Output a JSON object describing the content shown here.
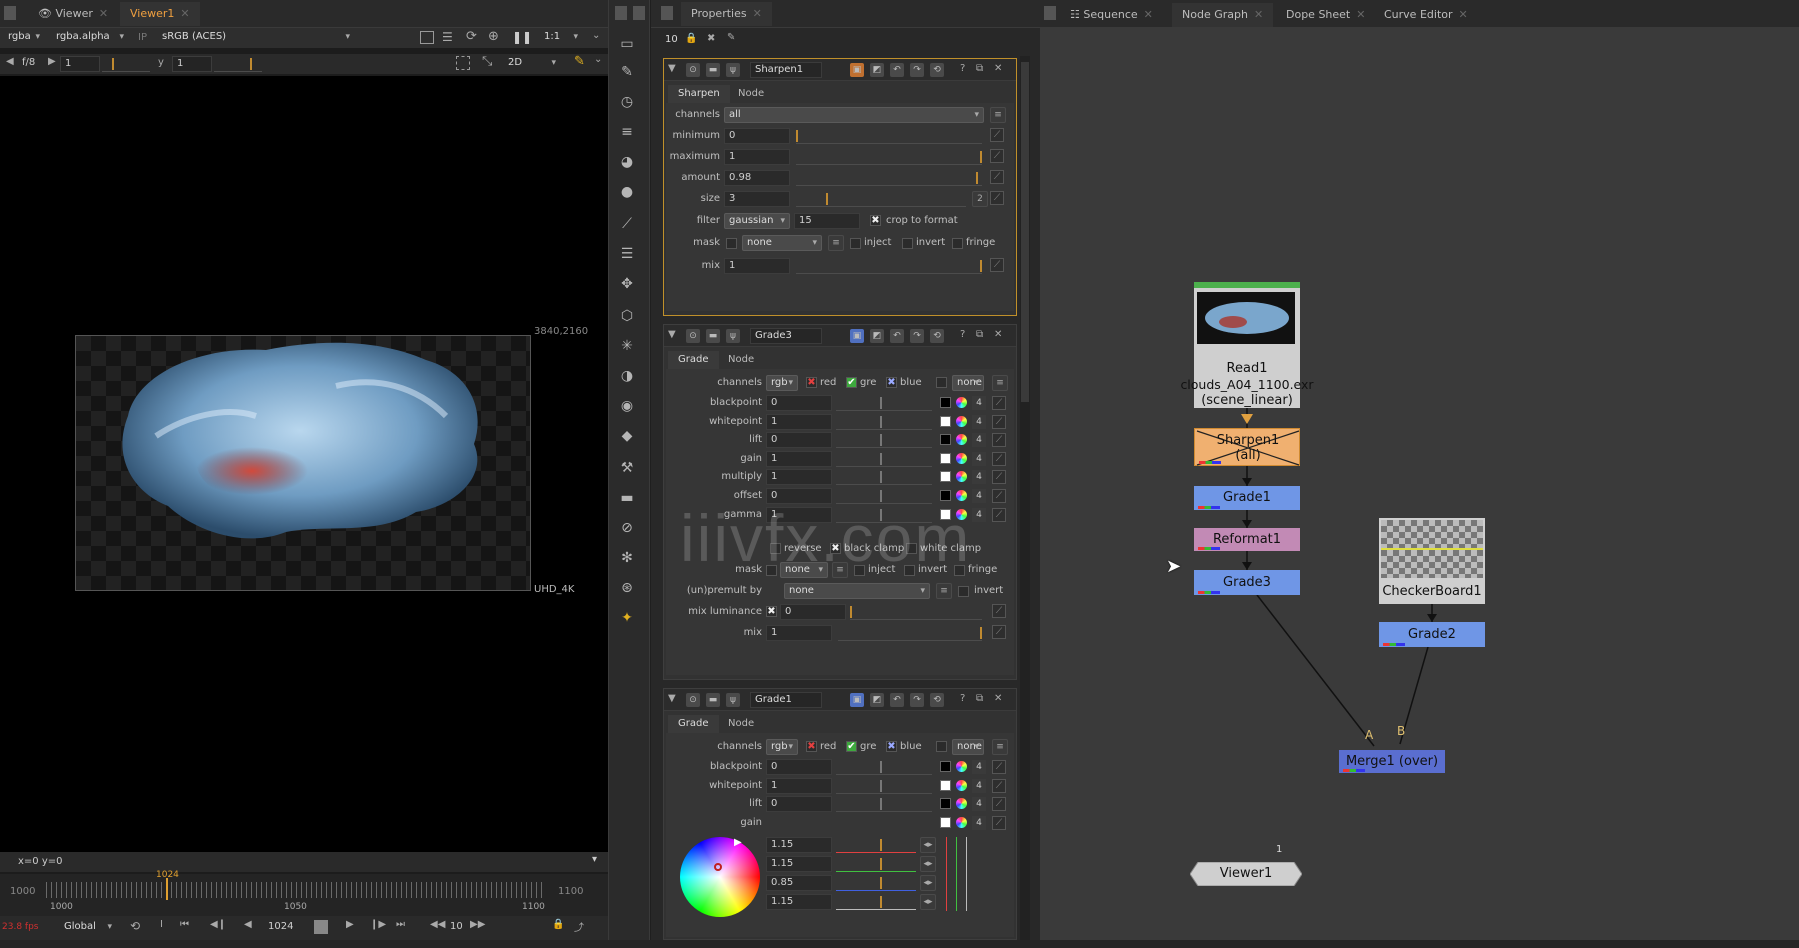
{
  "viewer": {
    "tabs": [
      {
        "label": "Viewer"
      },
      {
        "label": "Viewer1"
      }
    ],
    "channels": "rgba",
    "alpha": "rgba.alpha",
    "ip": "IP",
    "colorspace": "sRGB (ACES)",
    "zoom": "1:1",
    "fstop": "f/8",
    "gain_val": "1",
    "y_label": "y",
    "gamma_val": "1",
    "mode_2d": "2D",
    "format_dims": "3840,2160",
    "format_name": "UHD_4K",
    "coords": "x=0 y=0",
    "timeline": {
      "start_left": "1000",
      "end_right": "1100",
      "tick_1000": "1000",
      "tick_1050": "1050",
      "tick_1100": "1100",
      "current": "1024"
    },
    "transport": {
      "scope": "Global",
      "frame": "1024",
      "step": "10",
      "fps": "23.8 fps"
    }
  },
  "properties": {
    "tab": "Properties",
    "max_panels": "10",
    "sharpen": {
      "name": "Sharpen1",
      "tabs": [
        "Sharpen",
        "Node"
      ],
      "channels_label": "channels",
      "channels": "all",
      "minimum_label": "minimum",
      "minimum": "0",
      "maximum_label": "maximum",
      "maximum": "1",
      "amount_label": "amount",
      "amount": "0.98",
      "size_label": "size",
      "size": "3",
      "size_btn": "2",
      "filter_label": "filter",
      "filter": "gaussian",
      "filter_val": "15",
      "crop_label": "crop to format",
      "mask_label": "mask",
      "mask": "none",
      "inject": "inject",
      "invert": "invert",
      "fringe": "fringe",
      "mix_label": "mix",
      "mix": "1"
    },
    "grade3": {
      "name": "Grade3",
      "tabs": [
        "Grade",
        "Node"
      ],
      "channels_label": "channels",
      "channels": "rgb",
      "red": "red",
      "green": "gre",
      "blue": "blue",
      "none": "none",
      "rows": [
        {
          "label": "blackpoint",
          "value": "0",
          "swatch": "#000000"
        },
        {
          "label": "whitepoint",
          "value": "1",
          "swatch": "#ffffff"
        },
        {
          "label": "lift",
          "value": "0",
          "swatch": "#000000"
        },
        {
          "label": "gain",
          "value": "1",
          "swatch": "#ffffff"
        },
        {
          "label": "multiply",
          "value": "1",
          "swatch": "#ffffff"
        },
        {
          "label": "offset",
          "value": "0",
          "swatch": "#000000"
        },
        {
          "label": "gamma",
          "value": "1",
          "swatch": "#ffffff"
        }
      ],
      "reverse": "reverse",
      "black_clamp": "black clamp",
      "white_clamp": "white clamp",
      "mask_label": "mask",
      "mask": "none",
      "inject": "inject",
      "invert": "invert",
      "fringe": "fringe",
      "unpremult_label": "(un)premult by",
      "unpremult": "none",
      "unpremult_invert": "invert",
      "mixlum_label": "mix luminance",
      "mixlum": "0",
      "mix_label": "mix",
      "mix": "1"
    },
    "grade1": {
      "name": "Grade1",
      "tabs": [
        "Grade",
        "Node"
      ],
      "channels_label": "channels",
      "channels": "rgb",
      "red": "red",
      "green": "gre",
      "blue": "blue",
      "none": "none",
      "rows": [
        {
          "label": "blackpoint",
          "value": "0",
          "swatch": "#000000"
        },
        {
          "label": "whitepoint",
          "value": "1",
          "swatch": "#ffffff"
        },
        {
          "label": "lift",
          "value": "0",
          "swatch": "#000000"
        }
      ],
      "gain_label": "gain",
      "gain_values": [
        "1.15",
        "1.15",
        "0.85",
        "1.15"
      ]
    }
  },
  "nodegraph": {
    "tabs": [
      {
        "label": "Sequence"
      },
      {
        "label": "Node Graph"
      },
      {
        "label": "Dope Sheet"
      },
      {
        "label": "Curve Editor"
      }
    ],
    "nodes": {
      "read1": {
        "title": "Read1",
        "file": "clouds_A04_1100.exr",
        "cs": "(scene_linear)"
      },
      "sharpen1": {
        "title": "Sharpen1",
        "sub": "(all)"
      },
      "grade1": "Grade1",
      "reformat1": "Reformat1",
      "grade3": "Grade3",
      "checker": "CheckerBoard1",
      "grade2": "Grade2",
      "merge1": "Merge1 (over)",
      "viewer1": "Viewer1",
      "input_a": "A",
      "input_b": "B",
      "viewer_in": "1"
    }
  },
  "watermark": "iiivfx.com"
}
